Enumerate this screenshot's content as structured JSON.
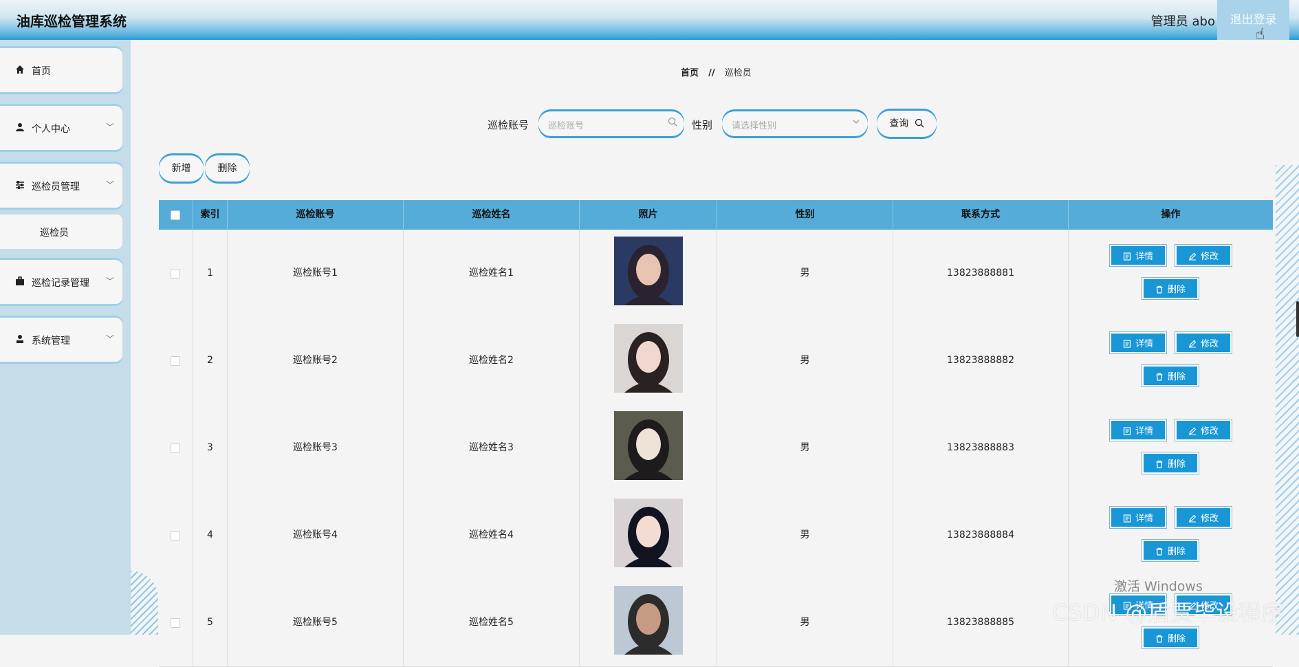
{
  "header": {
    "app_title": "油库巡检管理系统",
    "admin_label": "管理员 abo",
    "logout_label": "退出登录"
  },
  "sidebar": {
    "items": [
      {
        "label": "首页",
        "icon": "home-icon"
      },
      {
        "label": "个人中心",
        "icon": "user-icon"
      },
      {
        "label": "巡检员管理",
        "icon": "sliders-icon"
      },
      {
        "label": "巡检记录管理",
        "icon": "briefcase-icon"
      },
      {
        "label": "系统管理",
        "icon": "person-stamp-icon"
      }
    ],
    "sub_item": "巡检员"
  },
  "breadcrumb": {
    "home": "首页",
    "separator": "//",
    "current": "巡检员"
  },
  "search": {
    "account_label": "巡检账号",
    "account_placeholder": "巡检账号",
    "gender_label": "性别",
    "gender_placeholder": "请选择性别",
    "query_label": "查询"
  },
  "toolbar": {
    "add_label": "新增",
    "delete_label": "删除"
  },
  "table": {
    "columns": [
      "索引",
      "巡检账号",
      "巡检姓名",
      "照片",
      "性别",
      "联系方式",
      "操作"
    ],
    "actions": {
      "detail": "详情",
      "edit": "修改",
      "delete": "删除"
    },
    "rows": [
      {
        "index": "1",
        "account": "巡检账号1",
        "name": "巡检姓名1",
        "gender": "男",
        "phone": "13823888881"
      },
      {
        "index": "2",
        "account": "巡检账号2",
        "name": "巡检姓名2",
        "gender": "男",
        "phone": "13823888882"
      },
      {
        "index": "3",
        "account": "巡检账号3",
        "name": "巡检姓名3",
        "gender": "男",
        "phone": "13823888883"
      },
      {
        "index": "4",
        "account": "巡检账号4",
        "name": "巡检姓名4",
        "gender": "男",
        "phone": "13823888884"
      },
      {
        "index": "5",
        "account": "巡检账号5",
        "name": "巡检姓名5",
        "gender": "男",
        "phone": "13823888885"
      }
    ]
  },
  "overlay": {
    "activate_windows": "激活 Windows",
    "watermark": "CSDN @盾贾毕设程序"
  },
  "colors": {
    "header_blue": "#2a9bd4",
    "table_header": "#56acd8",
    "action_button": "#1996d6",
    "sidebar_bg": "#c5dde9"
  }
}
